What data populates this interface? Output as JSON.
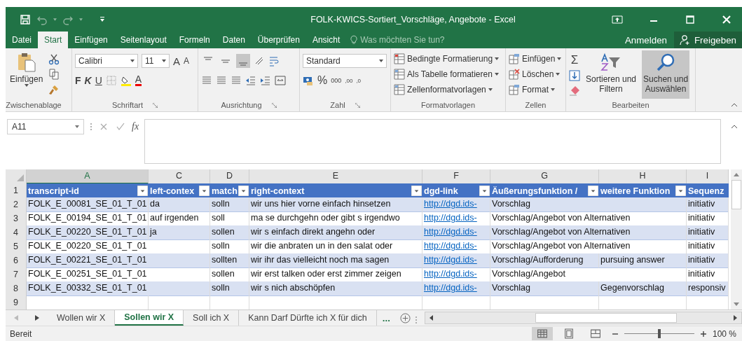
{
  "window": {
    "title": "FOLK-KWICS-Sortiert_Vorschläge, Angebote - Excel"
  },
  "menu_tabs": [
    {
      "label": "Datei",
      "selected": false
    },
    {
      "label": "Start",
      "selected": true
    },
    {
      "label": "Einfügen",
      "selected": false
    },
    {
      "label": "Seitenlayout",
      "selected": false
    },
    {
      "label": "Formeln",
      "selected": false
    },
    {
      "label": "Daten",
      "selected": false
    },
    {
      "label": "Überprüfen",
      "selected": false
    },
    {
      "label": "Ansicht",
      "selected": false
    }
  ],
  "tell_me": {
    "placeholder": "Was möchten Sie tun?"
  },
  "account": {
    "sign_in": "Anmelden",
    "share": "Freigeben"
  },
  "ribbon": {
    "clipboard": {
      "label": "Zwischenablage",
      "paste": "Einfügen"
    },
    "font": {
      "label": "Schriftart",
      "name": "Calibri",
      "size": "11",
      "grow": "A",
      "shrink": "A",
      "styles": [
        "F",
        "K",
        "U"
      ],
      "color_letter": "A"
    },
    "alignment": {
      "label": "Ausrichtung",
      "vertical": [
        {
          "kind": "top",
          "selected": false
        },
        {
          "kind": "middle",
          "selected": false
        },
        {
          "kind": "bottom",
          "selected": true
        }
      ]
    },
    "number": {
      "label": "Zahl",
      "format": "Standard",
      "percent": "%",
      "thousands": "000",
      "decimals": [
        ",00",
        ",0"
      ]
    },
    "styles": {
      "label": "Formatvorlagen",
      "commands": [
        "Bedingte Formatierung",
        "Als Tabelle formatieren",
        "Zellenformatvorlagen"
      ]
    },
    "cells": {
      "label": "Zellen",
      "commands": [
        "Einfügen",
        "Löschen",
        "Format"
      ]
    },
    "editing": {
      "label": "Bearbeiten",
      "sum": "Σ",
      "sort": [
        "Sortieren und",
        "Filtern"
      ],
      "find": {
        "lines": [
          "Suchen und",
          "Auswählen"
        ],
        "selected": true
      }
    }
  },
  "formula_bar": {
    "name_box": "A11",
    "fx": "fx"
  },
  "sheet": {
    "columns": [
      {
        "letter": "A",
        "selected": true,
        "kind": "text"
      },
      {
        "letter": "C",
        "selected": false,
        "kind": "text"
      },
      {
        "letter": "D",
        "selected": false,
        "kind": "text"
      },
      {
        "letter": "E",
        "selected": false,
        "kind": "text"
      },
      {
        "letter": "F",
        "selected": false,
        "kind": "link"
      },
      {
        "letter": "G",
        "selected": false,
        "kind": "text"
      },
      {
        "letter": "H",
        "selected": false,
        "kind": "text"
      },
      {
        "letter": "I",
        "selected": false,
        "kind": "text"
      }
    ],
    "header": {
      "number": "1",
      "cells": [
        {
          "text": "transcript-id",
          "filter": true
        },
        {
          "text": "left-contex",
          "filter": true
        },
        {
          "text": "match",
          "filter": true
        },
        {
          "text": "right-context",
          "filter": true
        },
        {
          "text": "dgd-link",
          "filter": true
        },
        {
          "text": "Äußerungsfunktion /",
          "filter": true
        },
        {
          "text": "weitere Funktion",
          "filter": true
        },
        {
          "text": "Sequenz",
          "filter": false
        }
      ]
    },
    "rows": [
      {
        "number": "2",
        "cells": [
          "FOLK_E_00081_SE_01_T_01",
          "da",
          "solln",
          "wir uns hier vorne einfach hinsetzen",
          "http://dgd.ids-",
          "Vorschlag",
          null,
          "initiativ"
        ]
      },
      {
        "number": "3",
        "cells": [
          "FOLK_E_00194_SE_01_T_01",
          "auf irgenden",
          "soll",
          "ma se durchgehn oder gibt s irgendwo",
          "http://dgd.ids-",
          "Vorschlag/Angebot von Alternativen",
          null,
          "initiativ"
        ]
      },
      {
        "number": "4",
        "cells": [
          "FOLK_E_00220_SE_01_T_01",
          "ja",
          "sollen",
          "wir s einfach direkt angehn oder",
          "http://dgd.ids-",
          "Vorschlag/Angebot von Alternativen",
          null,
          "initiativ"
        ]
      },
      {
        "number": "5",
        "cells": [
          "FOLK_E_00220_SE_01_T_01",
          null,
          "solln",
          "wir die anbraten un in den salat oder",
          "http://dgd.ids-",
          "Vorschlag/Angebot von Alternativen",
          null,
          "initiativ"
        ]
      },
      {
        "number": "6",
        "cells": [
          "FOLK_E_00221_SE_01_T_01",
          null,
          "sollten",
          "wir ihr das vielleicht noch ma sagen",
          "http://dgd.ids-",
          "Vorschlag/Aufforderung",
          "pursuing answer",
          "initiativ"
        ]
      },
      {
        "number": "7",
        "cells": [
          "FOLK_E_00251_SE_01_T_01",
          null,
          "sollen",
          "wir erst talken oder erst zimmer zeigen",
          "http://dgd.ids-",
          "Vorschlag/Angebot",
          null,
          "initiativ"
        ]
      },
      {
        "number": "8",
        "cells": [
          "FOLK_E_00332_SE_01_T_01",
          null,
          "solln",
          "wir s nich abschöpfen",
          "http://dgd.ids-",
          "Vorschlag",
          "Gegenvorschlag",
          "responsiv"
        ]
      },
      {
        "number": "9",
        "cells": [
          null,
          null,
          null,
          null,
          null,
          null,
          null,
          null
        ]
      }
    ]
  },
  "sheet_tabs": [
    {
      "label": "Wollen wir X",
      "selected": false
    },
    {
      "label": "Sollen wir X",
      "selected": true
    },
    {
      "label": "Soll ich X",
      "selected": false
    },
    {
      "label": "Kann Darf Dürfte ich X für dich",
      "selected": false
    }
  ],
  "more_sheets": "...",
  "status_bar": {
    "status": "Bereit",
    "views": [
      {
        "kind": "normal",
        "selected": true
      },
      {
        "kind": "layout",
        "selected": false
      },
      {
        "kind": "break",
        "selected": false
      }
    ],
    "zoom": {
      "level": 0.5,
      "reading": "100 %"
    }
  }
}
